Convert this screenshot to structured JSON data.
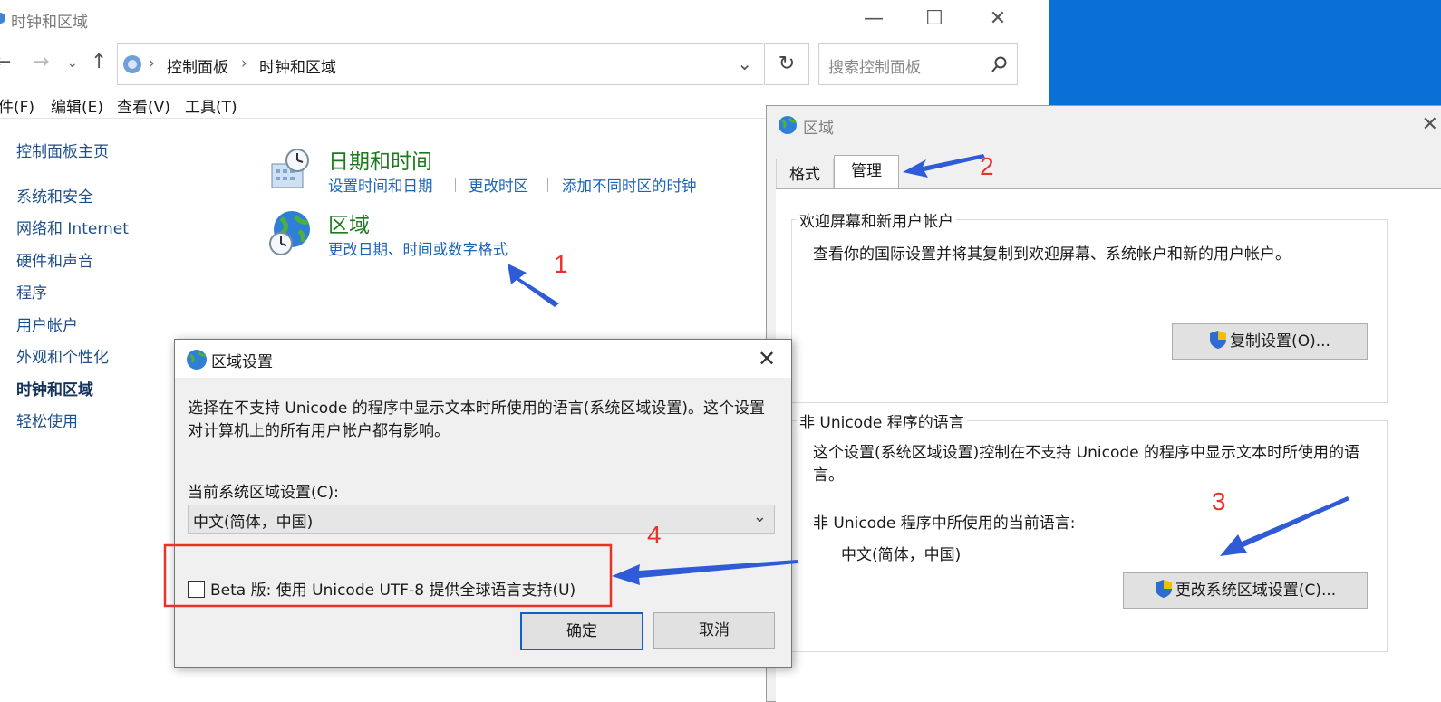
{
  "control_panel": {
    "title": "时钟和区域",
    "breadcrumb": [
      "控制面板",
      "时钟和区域"
    ],
    "search_placeholder": "搜索控制面板",
    "menu": [
      "件(F)",
      "编辑(E)",
      "查看(V)",
      "工具(T)"
    ],
    "sidebar": [
      {
        "label": "控制面板主页"
      },
      {
        "label": "系统和安全"
      },
      {
        "label": "网络和 Internet"
      },
      {
        "label": "硬件和声音"
      },
      {
        "label": "程序"
      },
      {
        "label": "用户帐户"
      },
      {
        "label": "外观和个性化"
      },
      {
        "label": "时钟和区域",
        "active": true
      },
      {
        "label": "轻松使用"
      }
    ],
    "categories": [
      {
        "title": "日期和时间",
        "icon": "clock-calendar-icon",
        "links": [
          "设置时间和日期",
          "更改时区",
          "添加不同时区的时钟"
        ]
      },
      {
        "title": "区域",
        "icon": "globe-clock-icon",
        "links": [
          "更改日期、时间或数字格式"
        ]
      }
    ]
  },
  "region_dialog": {
    "title": "区域",
    "tabs": [
      "格式",
      "管理"
    ],
    "active_tab": "管理",
    "welcome_group": {
      "label": "欢迎屏幕和新用户帐户",
      "text": "查看你的国际设置并将其复制到欢迎屏幕、系统帐户和新的用户帐户。",
      "button": "复制设置(O)..."
    },
    "non_unicode_group": {
      "label": "非 Unicode 程序的语言",
      "text": "这个设置(系统区域设置)控制在不支持 Unicode 的程序中显示文本时所使用的语言。",
      "current_label": "非 Unicode 程序中所使用的当前语言:",
      "current_value": "中文(简体，中国)",
      "button": "更改系统区域设置(C)..."
    }
  },
  "locale_dialog": {
    "title": "区域设置",
    "description": "选择在不支持 Unicode 的程序中显示文本时所使用的语言(系统区域设置)。这个设置对计算机上的所有用户帐户都有影响。",
    "current_label": "当前系统区域设置(C):",
    "current_value": "中文(简体，中国)",
    "beta_checkbox": {
      "label": "Beta 版: 使用 Unicode UTF-8 提供全球语言支持(U)",
      "checked": false
    },
    "ok": "确定",
    "cancel": "取消"
  },
  "annotations": [
    "1",
    "2",
    "3",
    "4"
  ],
  "colors": {
    "arrow": "#2f5bd6",
    "highlight": "#e8332a",
    "link": "#1a64b8",
    "category_title": "#1e7a1e",
    "desktop": "#0a6fd6"
  }
}
